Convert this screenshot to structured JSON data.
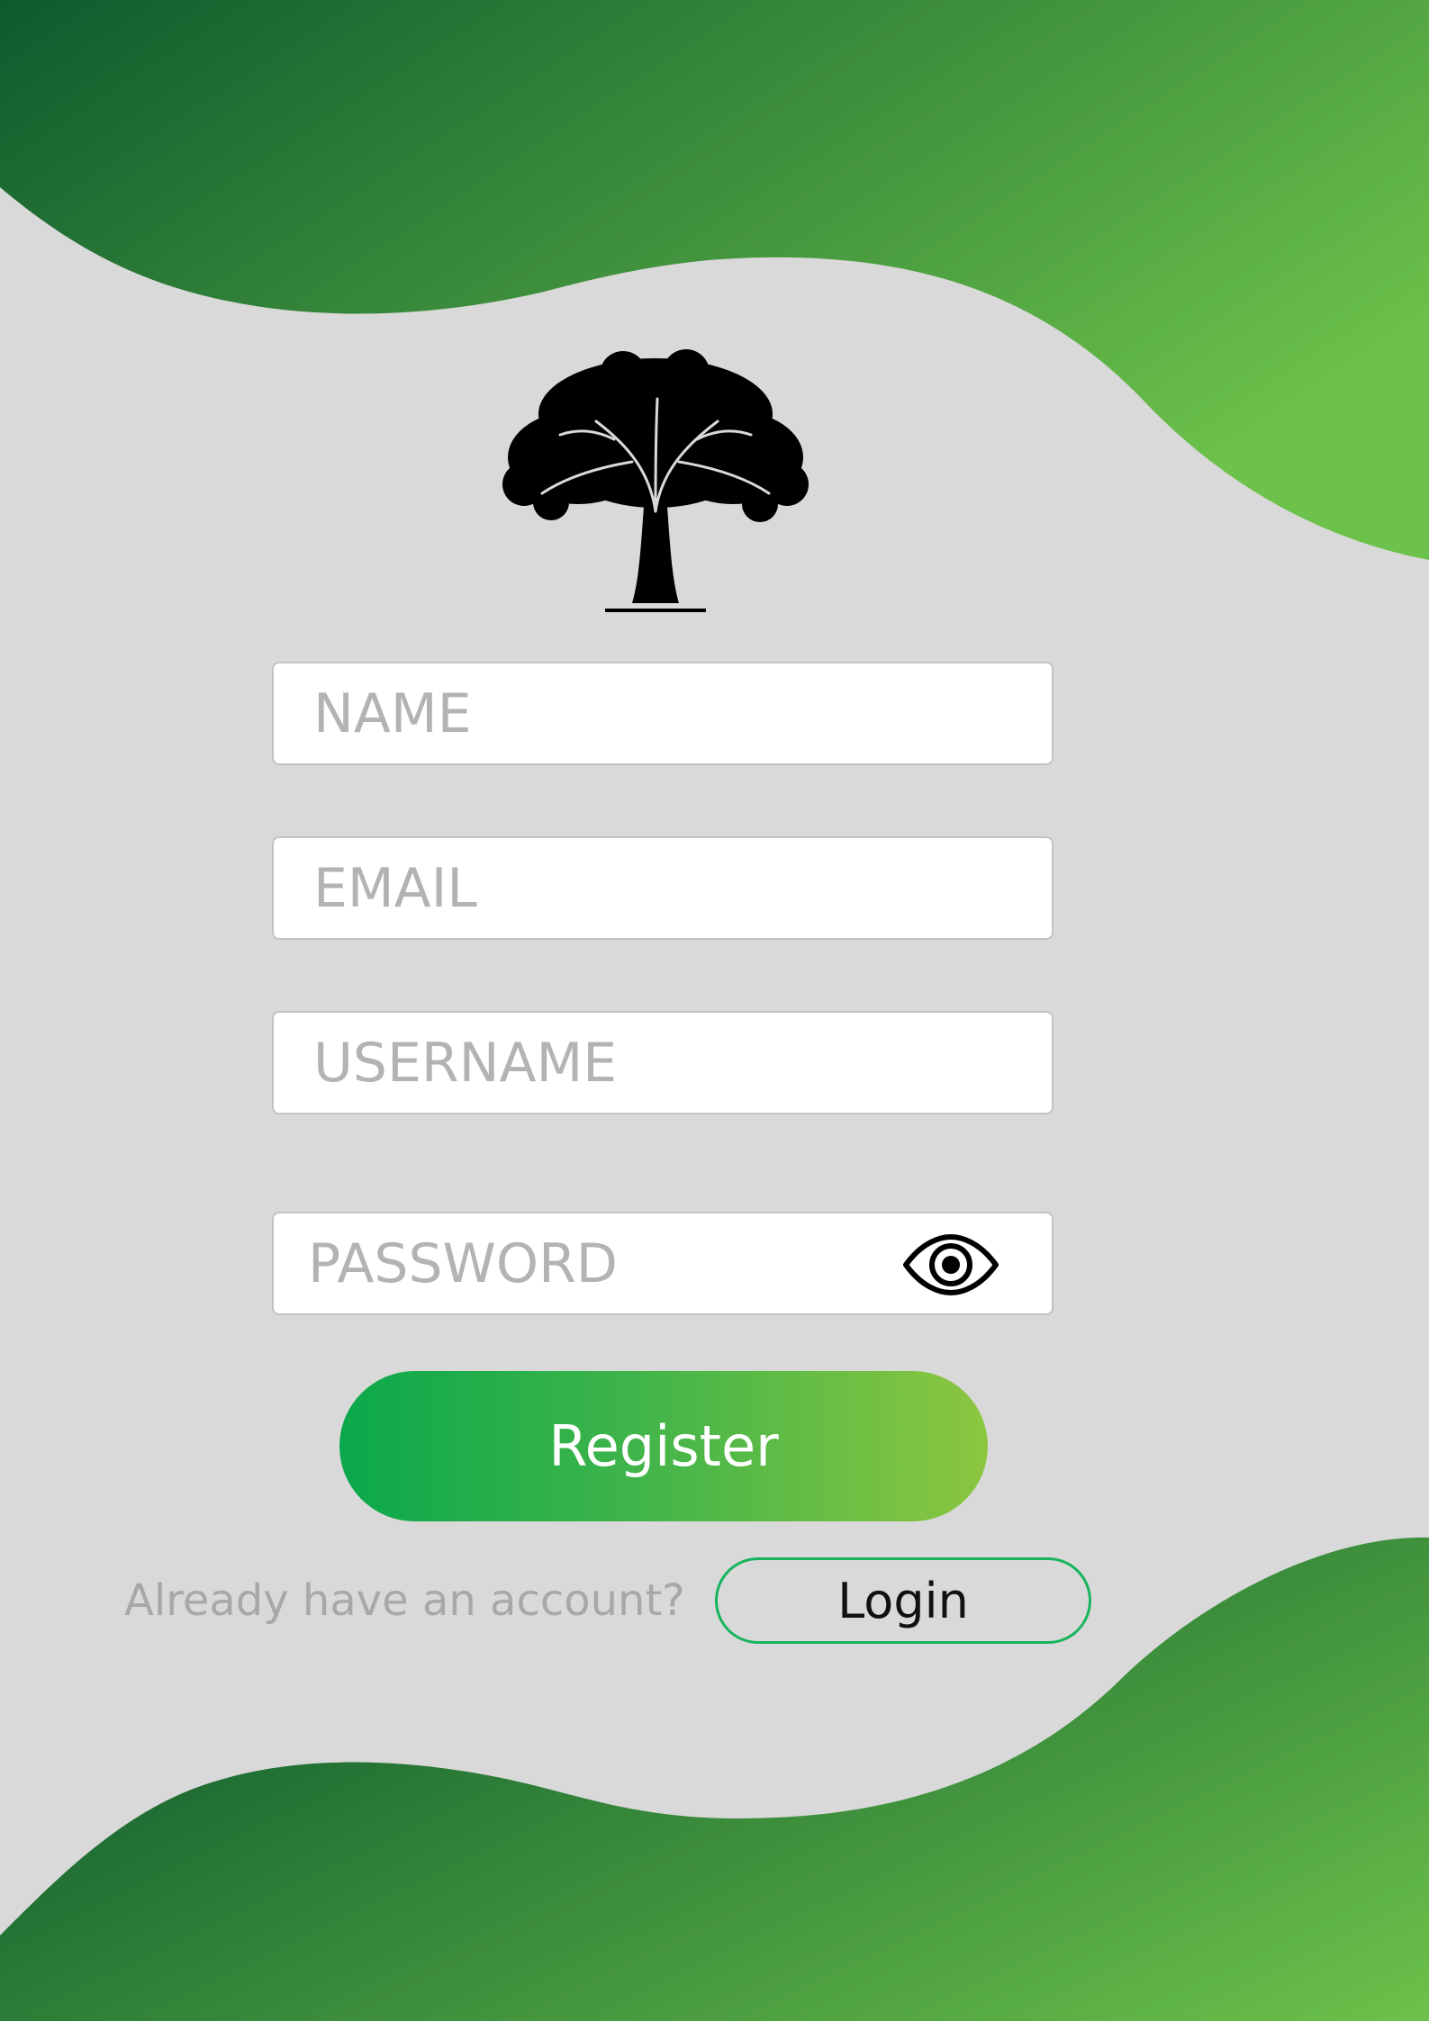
{
  "form": {
    "name_placeholder": "NAME",
    "email_placeholder": "EMAIL",
    "username_placeholder": "USERNAME",
    "password_placeholder": "PASSWORD"
  },
  "actions": {
    "register_label": "Register",
    "already_text": "Already have an account?",
    "login_label": "Login"
  },
  "icons": {
    "logo": "tree-icon",
    "password_toggle": "eye-icon"
  },
  "colors": {
    "background": "#d9d9d9",
    "wave_dark": "#0e5a2e",
    "wave_light": "#6cc24a",
    "register_gradient_start": "#0aa84b",
    "register_gradient_end": "#8cc63f",
    "login_border": "#17b45c",
    "placeholder": "#b3b3b3"
  }
}
